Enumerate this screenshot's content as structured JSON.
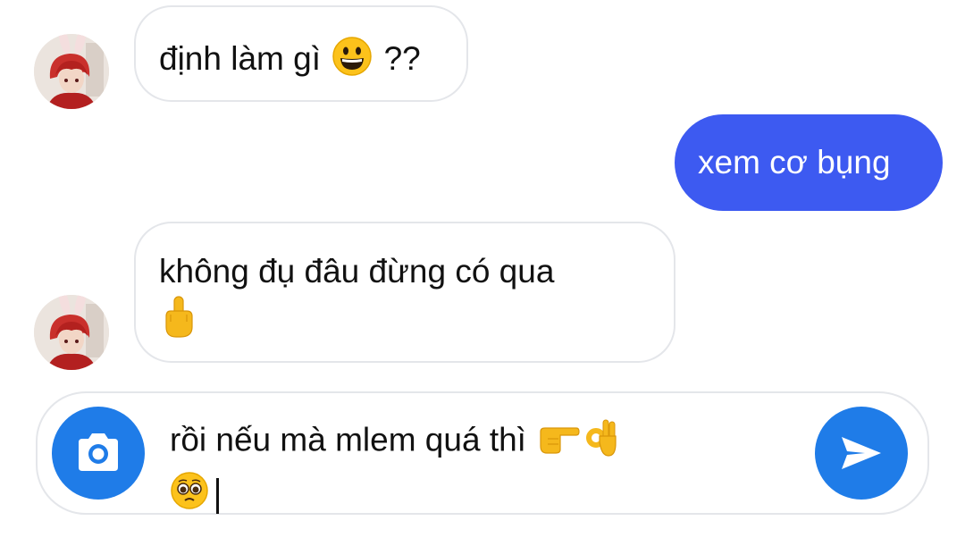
{
  "conversation": {
    "messages": [
      {
        "side": "incoming",
        "text": "định làm gì",
        "emoji": "grinning-face",
        "suffix": "??"
      },
      {
        "side": "outgoing",
        "text": "xem cơ bụng"
      },
      {
        "side": "incoming",
        "text": "không đụ đâu đừng có qua",
        "emoji": "middle-finger"
      }
    ]
  },
  "composer": {
    "text_line1": "rồi nếu mà mlem quá thì",
    "line1_emojis": [
      "pointing-right",
      "ok-hand"
    ],
    "line2_emoji": "pleading-face",
    "camera_icon": "camera-icon",
    "send_icon": "send-icon"
  },
  "colors": {
    "outgoing_bubble": "#3d5af1",
    "incoming_border": "#e4e6ea",
    "action_button": "#1f7ce8"
  }
}
